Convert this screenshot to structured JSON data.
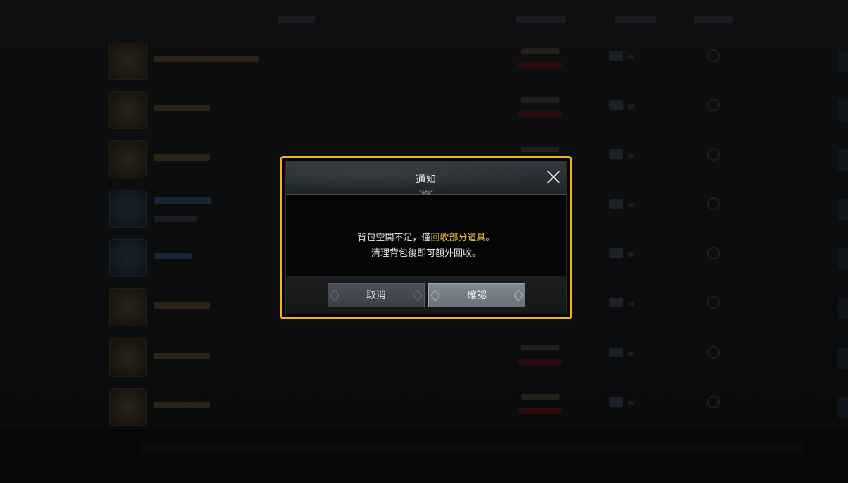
{
  "dialog": {
    "title": "通知",
    "message_prefix": "背包空間不足，僅",
    "message_highlight": "回收部分道具",
    "message_suffix": "。",
    "message_line2": "清理背包後即可額外回收。",
    "cancel_label": "取消",
    "confirm_label": "確認",
    "highlight_color": "#f2c23c",
    "frame_color": "#f6b21e"
  },
  "icons": {
    "close": "close-icon",
    "header_ornament": "ornament-icon"
  }
}
